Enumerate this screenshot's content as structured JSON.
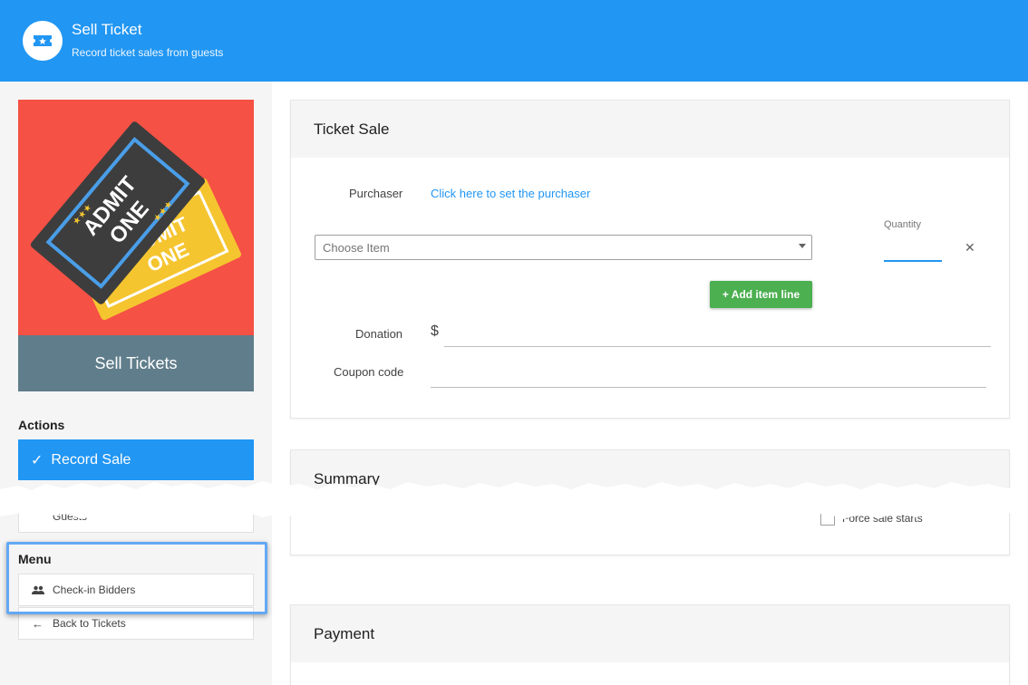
{
  "header": {
    "title": "Sell Ticket",
    "subtitle": "Record ticket sales from guests",
    "icon": "ticket-icon",
    "color": "#2196f3"
  },
  "sidebar": {
    "promo_image_text": [
      "ADMIT ONE",
      "ADMIT ONE"
    ],
    "promo_caption": "Sell Tickets",
    "actions_heading": "Actions",
    "primary_action": "Record Sale",
    "secondary_action": "Guests",
    "menu_heading": "Menu",
    "menu_items": [
      {
        "label": "Check-in Bidders",
        "icon": "people-icon"
      },
      {
        "label": "Back to Tickets",
        "icon": "arrow-left-icon"
      }
    ]
  },
  "ticket_sale": {
    "title": "Ticket Sale",
    "purchaser_label": "Purchaser",
    "purchaser_link": "Click here to set the purchaser",
    "item_placeholder": "Choose Item",
    "quantity_label": "Quantity",
    "add_item_label": "+ Add item line",
    "donation_label": "Donation",
    "donation_prefix": "$",
    "coupon_label": "Coupon code"
  },
  "summary": {
    "title": "Summary",
    "force_label": "Force sale starts"
  },
  "payment": {
    "title": "Payment"
  },
  "colors": {
    "primary": "#2196f3",
    "success": "#4caf50",
    "promo_bg": "#f55145",
    "caption_bg": "#607d8b"
  }
}
